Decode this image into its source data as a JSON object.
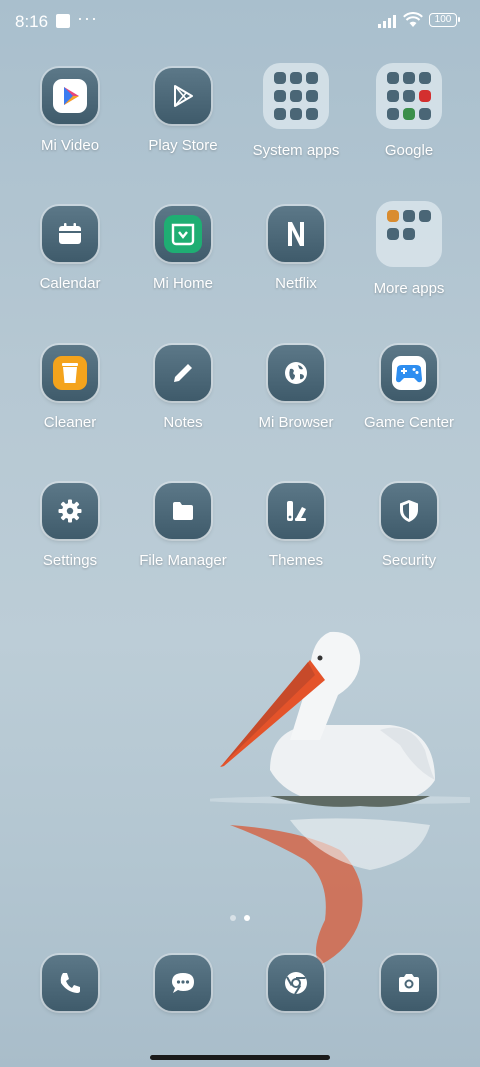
{
  "status_bar": {
    "time": "8:16",
    "more": "···",
    "battery": "100"
  },
  "apps": [
    {
      "label": "Mi Video",
      "icon": "mi-video-icon"
    },
    {
      "label": "Play Store",
      "icon": "play-store-icon"
    },
    {
      "label": "System apps",
      "icon": "folder-icon"
    },
    {
      "label": "Google",
      "icon": "folder-icon"
    },
    {
      "label": "Calendar",
      "icon": "calendar-icon"
    },
    {
      "label": "Mi Home",
      "icon": "mi-home-icon"
    },
    {
      "label": "Netflix",
      "icon": "netflix-icon"
    },
    {
      "label": "More apps",
      "icon": "folder-icon"
    },
    {
      "label": "Cleaner",
      "icon": "trash-icon"
    },
    {
      "label": "Notes",
      "icon": "pencil-icon"
    },
    {
      "label": "Mi Browser",
      "icon": "globe-icon"
    },
    {
      "label": "Game Center",
      "icon": "gamepad-icon"
    },
    {
      "label": "Settings",
      "icon": "gear-icon"
    },
    {
      "label": "File Manager",
      "icon": "folder-file-icon"
    },
    {
      "label": "Themes",
      "icon": "themes-icon"
    },
    {
      "label": "Security",
      "icon": "shield-icon"
    }
  ],
  "dock": [
    {
      "icon": "phone-icon"
    },
    {
      "icon": "message-icon"
    },
    {
      "icon": "chrome-icon"
    },
    {
      "icon": "camera-icon"
    }
  ],
  "page_indicator": {
    "pages": 2,
    "current": 2
  }
}
